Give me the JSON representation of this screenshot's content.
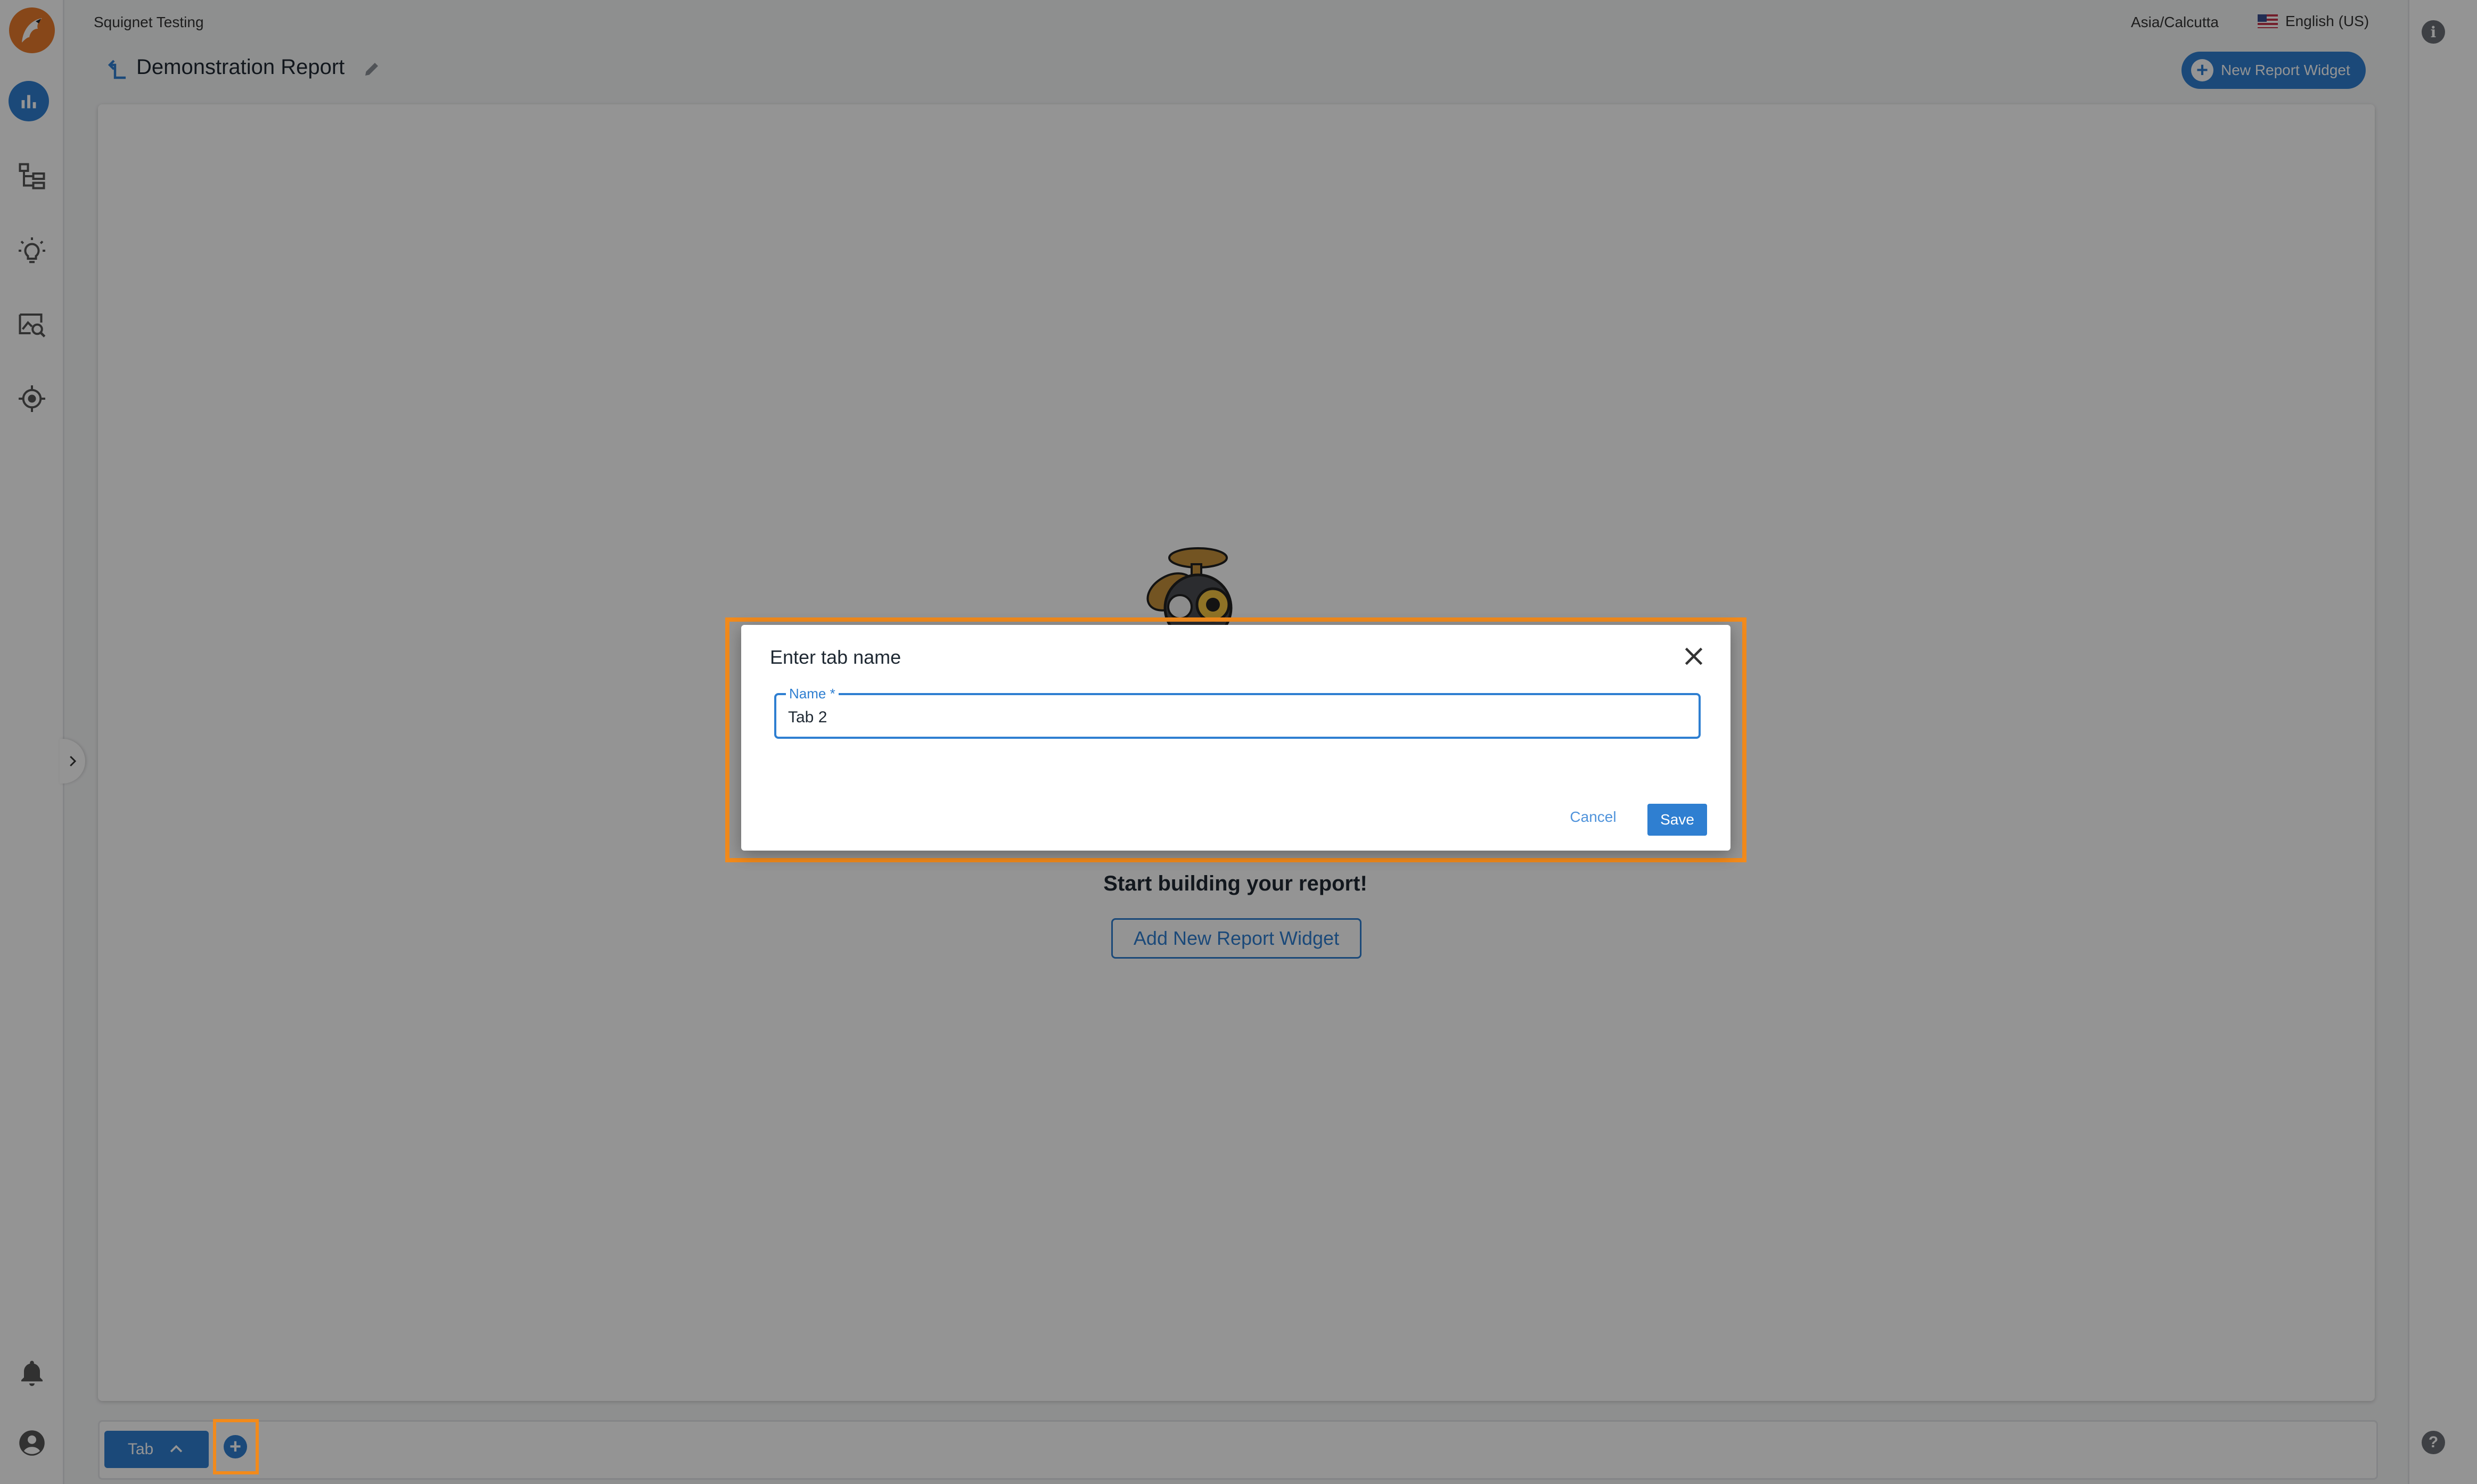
{
  "header": {
    "org_name": "Squignet Testing",
    "timezone": "Asia/Calcutta",
    "language": "English (US)"
  },
  "report": {
    "title": "Demonstration Report",
    "new_widget_label": "New Report Widget"
  },
  "empty_state": {
    "title": "Start building your report!",
    "add_widget_label": "Add New Report Widget"
  },
  "tabs": {
    "current_label": "Tab",
    "add_symbol": "+"
  },
  "dialog": {
    "title": "Enter tab name",
    "field_label": "Name *",
    "field_value": "Tab 2",
    "cancel_label": "Cancel",
    "save_label": "Save"
  },
  "sidebar": {
    "items": [
      {
        "icon": "bar-chart-icon",
        "active": true
      },
      {
        "icon": "hierarchy-icon",
        "active": false
      },
      {
        "icon": "lightbulb-icon",
        "active": false
      },
      {
        "icon": "image-search-icon",
        "active": false
      },
      {
        "icon": "location-target-icon",
        "active": false
      }
    ],
    "bottom": [
      "bell-icon",
      "account-icon"
    ]
  },
  "colors": {
    "accent": "#2f7fd1",
    "highlight": "#f28a1b",
    "brand": "#e87a2b"
  },
  "misc": {
    "info_symbol": "i",
    "help_symbol": "?"
  }
}
